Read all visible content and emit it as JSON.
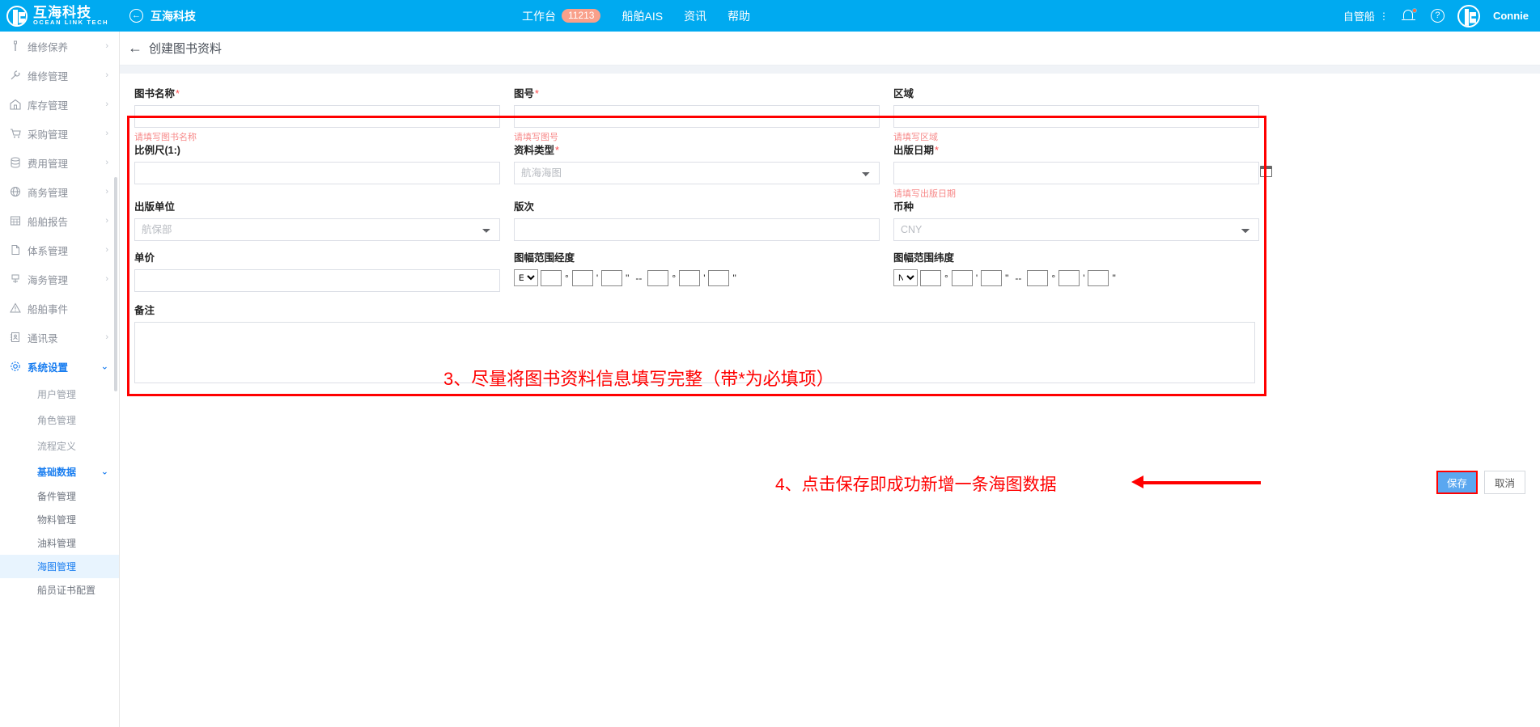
{
  "topbar": {
    "brand_cn": "互海科技",
    "brand_en": "OCEAN LINK TECH",
    "back_title": "互海科技",
    "nav": [
      {
        "label": "工作台",
        "badge": "11213"
      },
      {
        "label": "船舶AIS",
        "badge": ""
      },
      {
        "label": "资讯",
        "badge": ""
      },
      {
        "label": "帮助",
        "badge": ""
      }
    ],
    "ship_selector": "自管船",
    "user_name": "Connie"
  },
  "sidebar": {
    "items": [
      {
        "label": "维修保养",
        "icon": "wrench-tool-icon",
        "chevron": "›",
        "level": 0
      },
      {
        "label": "维修管理",
        "icon": "spanner-icon",
        "chevron": "›",
        "level": 0
      },
      {
        "label": "库存管理",
        "icon": "warehouse-icon",
        "chevron": "›",
        "level": 0
      },
      {
        "label": "采购管理",
        "icon": "cart-icon",
        "chevron": "›",
        "level": 0
      },
      {
        "label": "费用管理",
        "icon": "stack-icon",
        "chevron": "›",
        "level": 0
      },
      {
        "label": "商务管理",
        "icon": "globe-icon",
        "chevron": "›",
        "level": 0
      },
      {
        "label": "船舶报告",
        "icon": "report-icon",
        "chevron": "›",
        "level": 0
      },
      {
        "label": "体系管理",
        "icon": "document-icon",
        "chevron": "›",
        "level": 0
      },
      {
        "label": "海务管理",
        "icon": "anchor-icon",
        "chevron": "›",
        "level": 0
      },
      {
        "label": "船舶事件",
        "icon": "warning-triangle-icon",
        "chevron": "",
        "level": 0
      },
      {
        "label": "通讯录",
        "icon": "contacts-icon",
        "chevron": "›",
        "level": 0
      },
      {
        "label": "系统设置",
        "icon": "gear-icon",
        "chevron": "⌄",
        "level": 0,
        "active": true
      }
    ],
    "sub_items": [
      {
        "label": "用户管理"
      },
      {
        "label": "角色管理"
      },
      {
        "label": "流程定义"
      }
    ],
    "basic_data": {
      "label": "基础数据",
      "chevron": "⌄"
    },
    "basic_children": [
      {
        "label": "备件管理",
        "selected": false
      },
      {
        "label": "物料管理",
        "selected": false
      },
      {
        "label": "油料管理",
        "selected": false
      },
      {
        "label": "海图管理",
        "selected": true
      },
      {
        "label": "船员证书配置",
        "selected": false
      }
    ]
  },
  "page": {
    "title": "创建图书资料",
    "back_arrow": "←"
  },
  "form": {
    "book_name": {
      "label": "图书名称",
      "required": "*",
      "value": "",
      "error": "请填写图书名称"
    },
    "chart_no": {
      "label": "图号",
      "required": "*",
      "value": "",
      "error": "请填写图号"
    },
    "region": {
      "label": "区域",
      "required": "",
      "value": "",
      "error": "请填写区域"
    },
    "scale": {
      "label": "比例尺(1:)",
      "required": "",
      "value": ""
    },
    "data_type": {
      "label": "资料类型",
      "required": "*",
      "value": "航海海图"
    },
    "publish_date": {
      "label": "出版日期",
      "required": "*",
      "value": "",
      "error": "请填写出版日期"
    },
    "publisher": {
      "label": "出版单位",
      "required": "",
      "value": "航保部"
    },
    "edition": {
      "label": "版次",
      "required": "",
      "value": ""
    },
    "currency": {
      "label": "币种",
      "required": "",
      "value": "CNY"
    },
    "unit_price": {
      "label": "单价",
      "required": "",
      "value": ""
    },
    "longitude": {
      "label": "图幅范围经度",
      "hemisphere": "E",
      "deg_symbol": "°",
      "min_symbol": "'",
      "sec_symbol": "\"",
      "dash": "--"
    },
    "latitude": {
      "label": "图幅范围纬度",
      "hemisphere": "N",
      "deg_symbol": "°",
      "min_symbol": "'",
      "sec_symbol": "\"",
      "dash": "--"
    },
    "remark": {
      "label": "备注",
      "value": ""
    }
  },
  "annotations": {
    "step3": "3、尽量将图书资料信息填写完整（带*为必填项）",
    "step4": "4、点击保存即成功新增一条海图数据"
  },
  "actions": {
    "save": "保存",
    "cancel": "取消"
  },
  "colors": {
    "brand_blue": "#00aaf0",
    "accent_blue": "#1a7ef0",
    "annotation_red": "#ff0000",
    "error_red": "#f78a8a",
    "badge_orange": "#f9a08a"
  }
}
